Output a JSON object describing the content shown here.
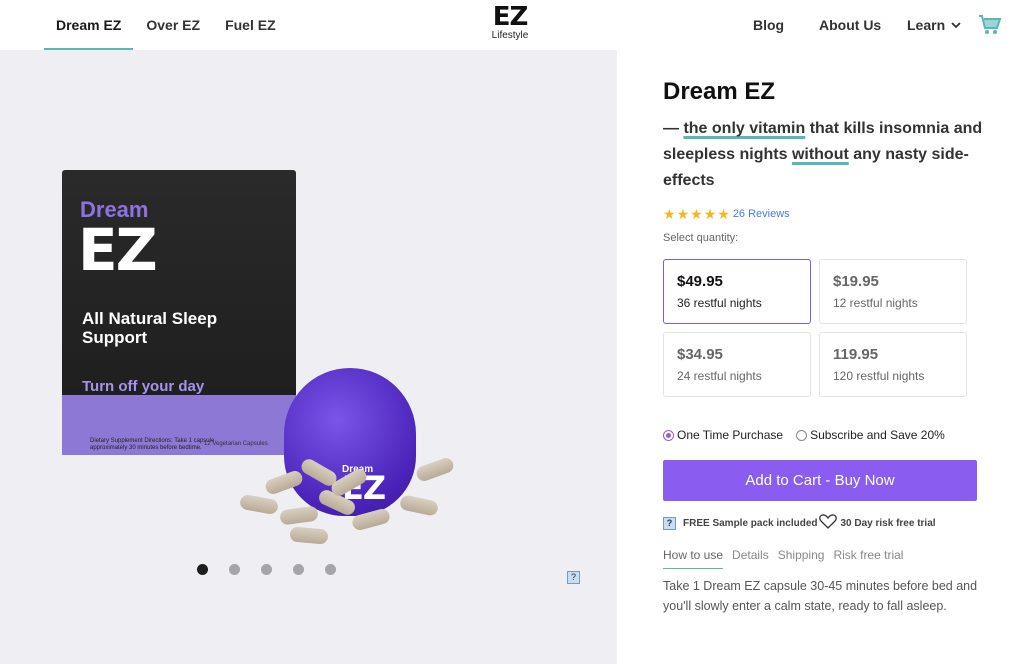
{
  "nav": {
    "left": [
      "Dream EZ",
      "Over EZ",
      "Fuel EZ"
    ],
    "right": {
      "blog": "Blog",
      "about": "About Us",
      "learn": "Learn"
    }
  },
  "logo": {
    "mark": "EZ",
    "sub": "Lifestyle"
  },
  "icons": {
    "cart": "cart-icon",
    "chevron": "chevron-down-icon",
    "star": "star-icon",
    "heart": "heart-icon"
  },
  "colors": {
    "accent": "#8a5cf0",
    "underline": "#5bb6b8",
    "star": "#f2b81c",
    "link": "#4a7bd6"
  },
  "gallery": {
    "box": {
      "dream": "Dream",
      "ez": "EZ",
      "tagline": "All Natural Sleep Support",
      "turn": "Turn off your day",
      "small": "Dietary Supplement Directions: Take 1 capsule approximately 30 minutes before bedtime.",
      "caps": "12 Vegetarian Capsules"
    },
    "container": {
      "dream": "Dream",
      "ez": "EZ"
    },
    "dots_total": 5,
    "active_dot": 1
  },
  "product": {
    "title": "Dream EZ",
    "subtitle": {
      "p1": "— ",
      "u1": "the only vitamin",
      "p2": " that kills insomnia and sleepless nights ",
      "u2": "without",
      "p3": " any nasty side-effects"
    },
    "rating": 5,
    "reviews": "26 Reviews",
    "select_label": "Select quantity:",
    "options": [
      {
        "price": "$49.95",
        "nights": "36 restful nights",
        "selected": true
      },
      {
        "price": "$19.95",
        "nights": "12 restful nights",
        "selected": false
      },
      {
        "price": "$34.95",
        "nights": "24 restful nights",
        "selected": false
      },
      {
        "price": "119.95",
        "nights": "120 restful nights",
        "selected": false
      }
    ],
    "purchase": {
      "one_time": "One Time Purchase",
      "subscribe": "Subscribe and Save 20%"
    },
    "cta": "Add to Cart - Buy Now",
    "perks": {
      "sample": "FREE Sample pack included",
      "trial": "30 Day risk free trial"
    },
    "tabs": [
      "How to use",
      "Details",
      "Shipping",
      "Risk free trial"
    ],
    "description": "Take 1 Dream EZ capsule 30-45 minutes before bed and you'll slowly enter a calm state, ready to fall asleep."
  }
}
